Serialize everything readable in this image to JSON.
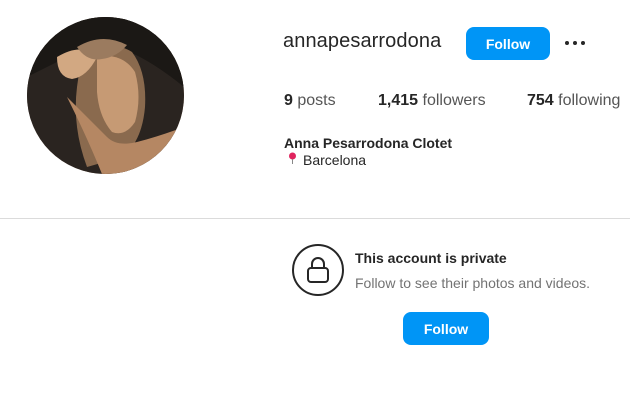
{
  "profile": {
    "username": "annapesarrodona",
    "follow_label": "Follow",
    "more_icon": "more-horizontal-icon",
    "stats": {
      "posts_count": "9",
      "posts_label": "posts",
      "followers_count": "1,415",
      "followers_label": "followers",
      "following_count": "754",
      "following_label": "following"
    },
    "full_name": "Anna Pesarrodona Clotet",
    "location_icon": "pin-icon",
    "location": "Barcelona"
  },
  "private_notice": {
    "icon": "lock-icon",
    "title": "This account is private",
    "subtitle": "Follow to see their photos and videos.",
    "follow_label": "Follow"
  },
  "colors": {
    "accent": "#0095f6",
    "text": "#262626",
    "muted": "#737373",
    "divider": "#dbdbdb",
    "pin": "#e0245e"
  }
}
